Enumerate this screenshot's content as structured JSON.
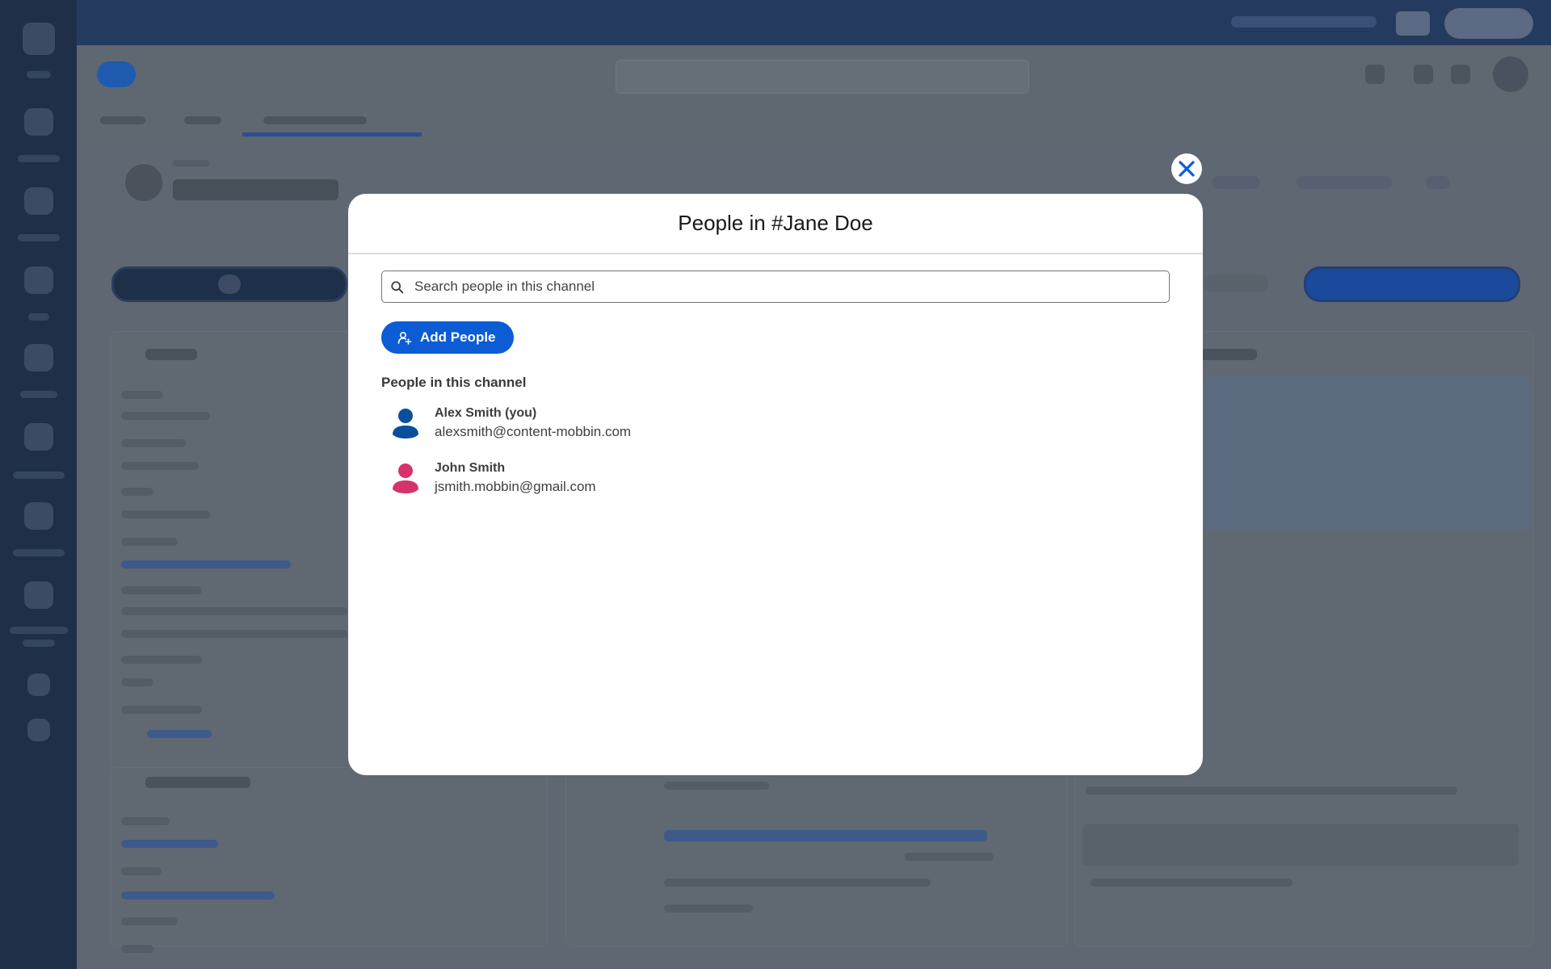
{
  "modal": {
    "title": "People in #Jane Doe",
    "search_placeholder": "Search people in this channel",
    "search_value": "",
    "add_people_label": "Add People",
    "section_label": "People in this channel",
    "people": [
      {
        "name": "Alex Smith (you)",
        "email": "alexsmith@content-mobbin.com",
        "avatar_color": "#0b4f9c",
        "icon": "user-avatar-icon"
      },
      {
        "name": "John Smith",
        "email": "jsmith.mobbin@gmail.com",
        "avatar_color": "#d6336c",
        "icon": "user-avatar-icon"
      }
    ]
  },
  "colors": {
    "accent": "#0b5cd5",
    "overlay": "#5e6772",
    "sidebar": "#1f2f48"
  },
  "icons": {
    "close": "close-icon",
    "search": "search-icon",
    "add_person": "add-person-icon"
  }
}
